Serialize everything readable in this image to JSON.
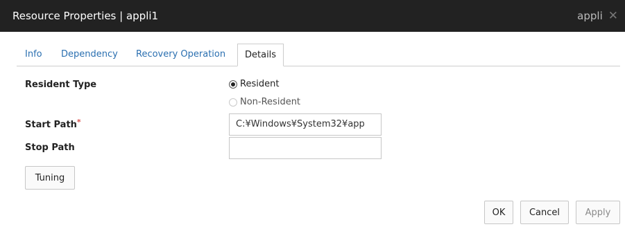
{
  "window": {
    "title": "Resource Properties | appli1",
    "right_label": "appli",
    "close_icon": "close-icon"
  },
  "tabs": [
    {
      "label": "Info"
    },
    {
      "label": "Dependency"
    },
    {
      "label": "Recovery Operation"
    },
    {
      "label": "Details",
      "active": true
    }
  ],
  "form": {
    "resident_type": {
      "label": "Resident Type",
      "options": [
        {
          "label": "Resident",
          "checked": true
        },
        {
          "label": "Non-Resident",
          "checked": false,
          "disabled": true
        }
      ]
    },
    "start_path": {
      "label": "Start Path",
      "required_mark": "*",
      "value": "C:¥Windows¥System32¥app"
    },
    "stop_path": {
      "label": "Stop Path",
      "value": ""
    },
    "tuning_button": "Tuning"
  },
  "footer": {
    "ok": "OK",
    "cancel": "Cancel",
    "apply": "Apply"
  }
}
